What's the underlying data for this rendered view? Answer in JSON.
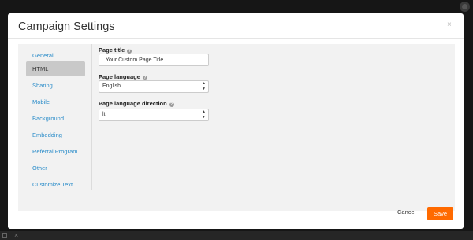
{
  "dialog": {
    "title": "Campaign Settings",
    "close": "×"
  },
  "sidebar": {
    "items": [
      {
        "label": "General"
      },
      {
        "label": "HTML"
      },
      {
        "label": "Sharing"
      },
      {
        "label": "Mobile"
      },
      {
        "label": "Background"
      },
      {
        "label": "Embedding"
      },
      {
        "label": "Referral Program"
      },
      {
        "label": "Other"
      },
      {
        "label": "Customize Text"
      }
    ],
    "active_label": "HTML"
  },
  "form": {
    "page_title": {
      "label": "Page title",
      "value": "Your Custom Page Title"
    },
    "page_language": {
      "label": "Page language",
      "value": "English"
    },
    "page_language_direction": {
      "label": "Page language direction",
      "value": "ltr"
    },
    "help_glyph": "?"
  },
  "footer": {
    "cancel_label": "Cancel",
    "save_label": "Save"
  },
  "colors": {
    "accent": "#ff6a00",
    "link": "#2a8cc9"
  }
}
